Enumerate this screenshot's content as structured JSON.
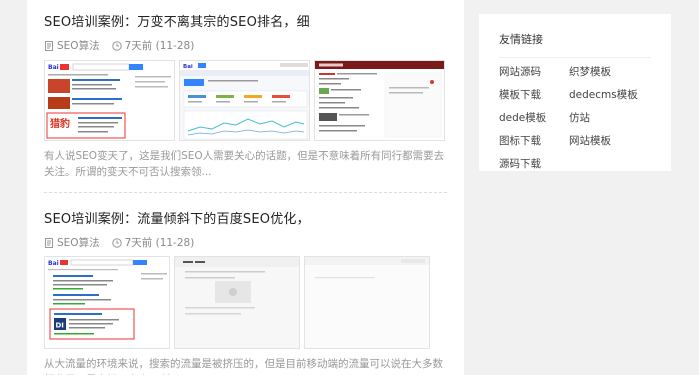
{
  "posts": [
    {
      "title": "SEO培训案例：万变不离其宗的SEO排名，细",
      "category": "SEO算法",
      "time": "7天前 (11-28)",
      "excerpt": "有人说SEO变天了，这是我们SEO人需要关心的话题，但是不意味着所有同行都需要去关注。所谓的变天不可否认搜索领..."
    },
    {
      "title": "SEO培训案例：流量倾斜下的百度SEO优化，",
      "category": "SEO算法",
      "time": "7天前 (11-28)",
      "excerpt": "从大流量的环境来说，搜索的流量是被挤压的，但是目前移动端的流量可以说在大多数行业里面是占据了多少，所以..."
    }
  ],
  "sidebar": {
    "title": "友情链接",
    "links": [
      "网站源码",
      "织梦模板",
      "模板下载",
      "dedecms模板",
      "dede模板",
      "仿站",
      "图标下载",
      "网站模板",
      "源码下载"
    ]
  },
  "icons": {
    "category": "document-icon",
    "time": "clock-icon"
  },
  "colors": {
    "main_bg": "#ffffff",
    "page_bg": "#f1f1f1",
    "meta_text": "#888888",
    "excerpt_text": "#999999"
  }
}
